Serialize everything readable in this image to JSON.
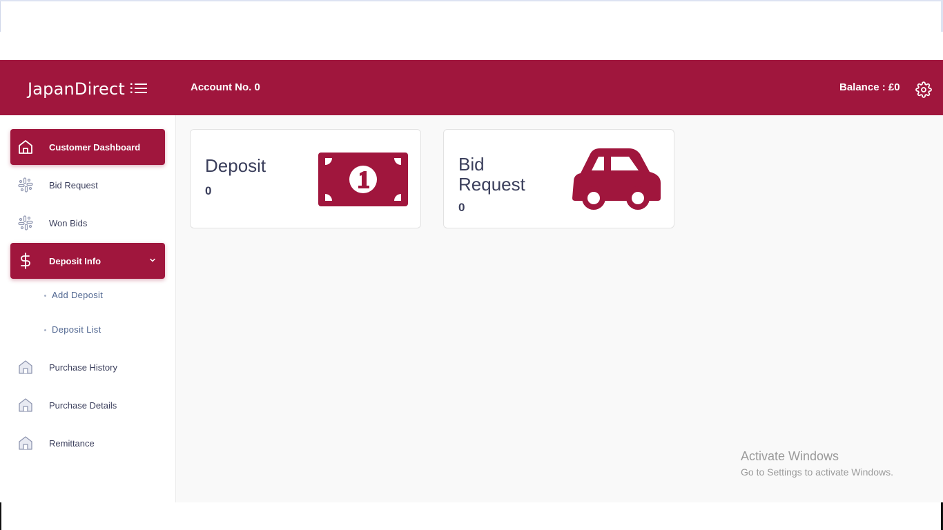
{
  "brand": {
    "logo_text": "JapanDirect"
  },
  "header": {
    "account_label": "Account No. 0",
    "balance_label": "Balance : £0",
    "background": "#a0163d"
  },
  "sidebar": {
    "items": [
      {
        "label": "Customer Dashboard",
        "icon": "home-icon",
        "active": true
      },
      {
        "label": "Bid Request",
        "icon": "slack-icon",
        "active": false
      },
      {
        "label": "Won Bids",
        "icon": "slack-icon",
        "active": false
      },
      {
        "label": "Deposit Info",
        "icon": "dollar-icon",
        "active": true,
        "expanded": true,
        "children": [
          {
            "label": "Add Deposit"
          },
          {
            "label": "Deposit List"
          }
        ]
      },
      {
        "label": "Purchase History",
        "icon": "home-icon",
        "active": false
      },
      {
        "label": "Purchase Details",
        "icon": "home-icon",
        "active": false
      },
      {
        "label": "Remittance",
        "icon": "home-icon",
        "active": false
      }
    ]
  },
  "cards": [
    {
      "title": "Deposit",
      "value": "0",
      "icon": "money-bill-icon"
    },
    {
      "title_line1": "Bid",
      "title_line2": "Request",
      "value": "0",
      "icon": "car-icon"
    }
  ],
  "watermark": {
    "line1": "Activate Windows",
    "line2": "Go to Settings to activate Windows."
  },
  "colors": {
    "accent": "#a0163d",
    "text": "#3b3f5c",
    "content_bg": "#f9f9f9"
  }
}
